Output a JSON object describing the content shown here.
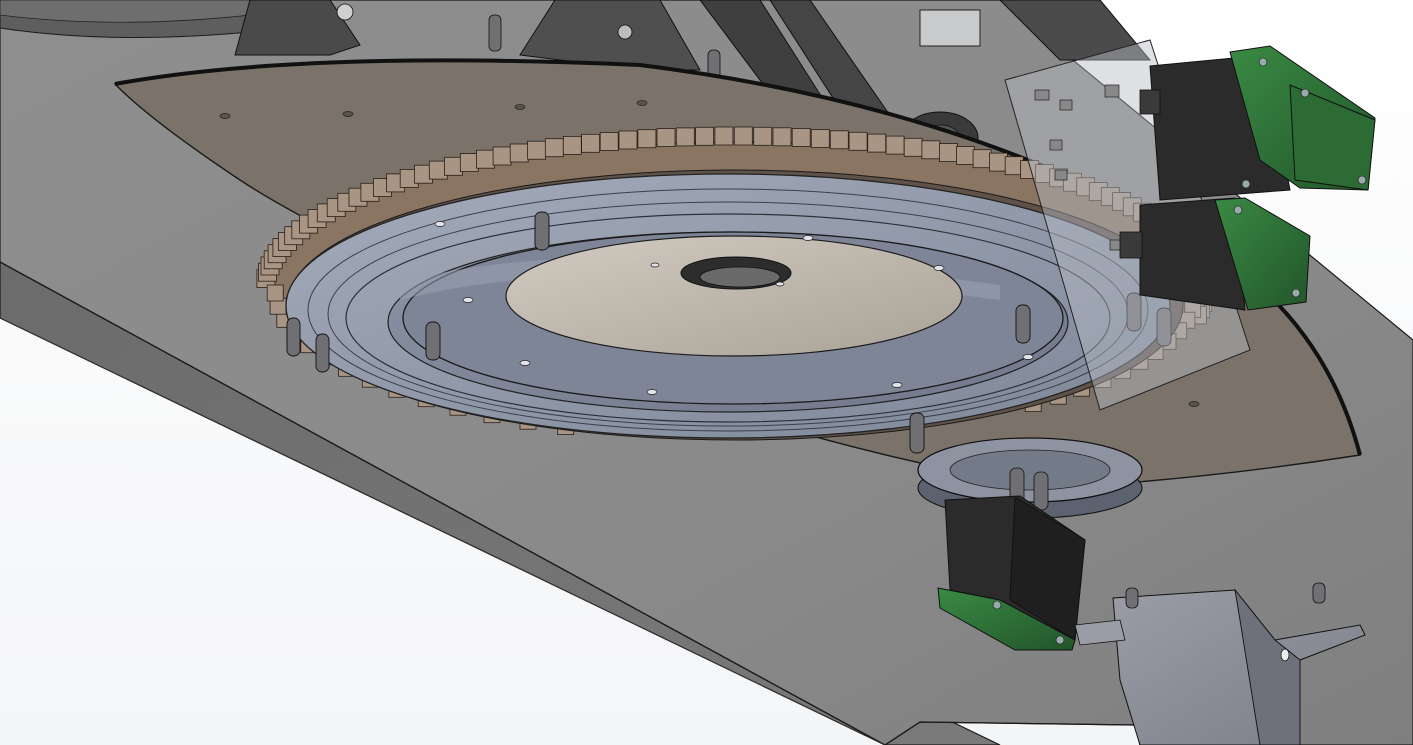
{
  "viewport": {
    "background": "#ffffff"
  },
  "scene": {
    "description_colors": {
      "base_plate_top": "#8c8c8c",
      "base_plate_side": "#5a5a5a",
      "outline": "#1a1a1a",
      "bronze_plate": "#7b736a",
      "gear_teeth": "#8a7462",
      "gear_teeth_light": "#a89584",
      "ring_glass": "#8c96a8",
      "inner_disc": "#7d8597",
      "center_disc": "#bdb6ab",
      "motor_body": "#2b2b2b",
      "motor_pcb_green": "#2f6b36",
      "bracket": "#8a8d96",
      "post": "#6f6f74"
    }
  }
}
